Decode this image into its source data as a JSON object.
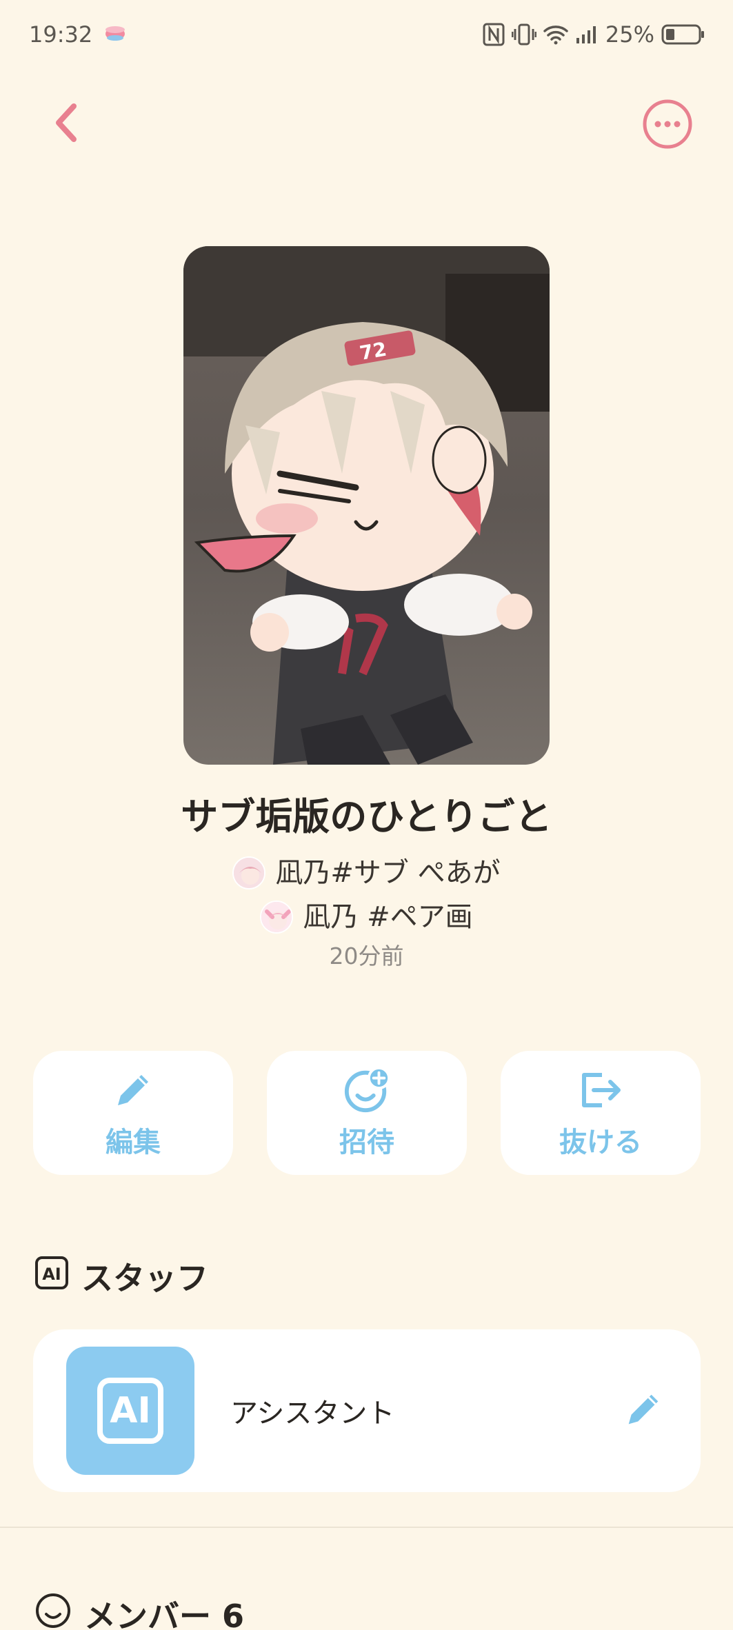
{
  "status_bar": {
    "time": "19:32",
    "battery": "25%",
    "icons": [
      "tea-cup-icon",
      "nfc-icon",
      "vibrate-icon",
      "wifi-icon",
      "signal-icon",
      "battery-icon"
    ]
  },
  "nav": {
    "back_icon": "chevron-left-icon",
    "more_icon": "more-horizontal-icon",
    "accent": "#e8808f"
  },
  "room": {
    "title": "サブ垢版のひとりごと",
    "owners": [
      {
        "name": "凪乃#サブ ぺあが"
      },
      {
        "name": "凪乃 #ペア画"
      }
    ],
    "updated": "20分前"
  },
  "actions": [
    {
      "label": "編集",
      "icon": "pencil-icon"
    },
    {
      "label": "招待",
      "icon": "add-person-smile-icon"
    },
    {
      "label": "抜ける",
      "icon": "leave-icon"
    }
  ],
  "staff_section": {
    "title": "スタッフ",
    "icon": "ai-badge-icon",
    "members": [
      {
        "name": "アシスタント",
        "avatar_text": "AI"
      }
    ]
  },
  "members_section": {
    "title": "メンバー 6",
    "icon": "smile-circle-icon"
  },
  "colors": {
    "background": "#fdf6e8",
    "action_blue": "#7cc4ea",
    "ai_blue": "#8ccbf0"
  }
}
